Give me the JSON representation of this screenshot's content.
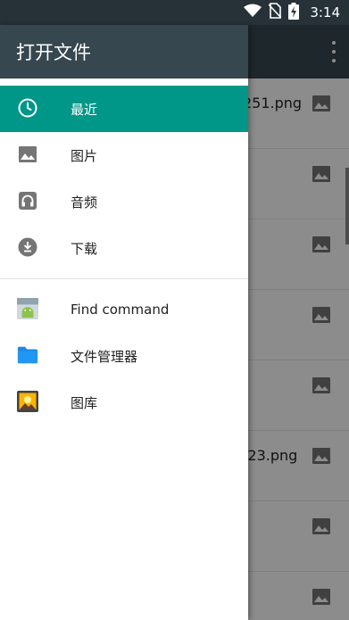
{
  "status_bar": {
    "time": "3:14",
    "icons": [
      "wifi-icon",
      "no-sim-icon",
      "battery-charging-icon"
    ]
  },
  "background": {
    "toolbar_menu_icon": "more-vert-icon",
    "rows": [
      {
        "text": "251.png",
        "icon": "image-icon"
      },
      {
        "text": "",
        "icon": "image-icon"
      },
      {
        "text": "",
        "icon": "image-icon"
      },
      {
        "text": "",
        "icon": "image-icon"
      },
      {
        "text": "",
        "icon": "image-icon"
      },
      {
        "text": ":23.png",
        "icon": "image-icon"
      },
      {
        "text": "",
        "icon": "image-icon"
      },
      {
        "text": "",
        "icon": "image-icon"
      }
    ]
  },
  "drawer": {
    "title": "打开文件",
    "roots": [
      {
        "label": "最近",
        "icon": "clock-icon",
        "active": true
      },
      {
        "label": "图片",
        "icon": "image-icon",
        "active": false
      },
      {
        "label": "音频",
        "icon": "headphones-icon",
        "active": false
      },
      {
        "label": "下载",
        "icon": "download-icon",
        "active": false
      }
    ],
    "apps": [
      {
        "label": "Find command",
        "icon": "android-app-icon"
      },
      {
        "label": "文件管理器",
        "icon": "folder-icon"
      },
      {
        "label": "图库",
        "icon": "gallery-app-icon"
      }
    ]
  },
  "colors": {
    "status_bar": "#263238",
    "toolbar": "#37474f",
    "accent": "#009688",
    "folder": "#1e88e5"
  }
}
